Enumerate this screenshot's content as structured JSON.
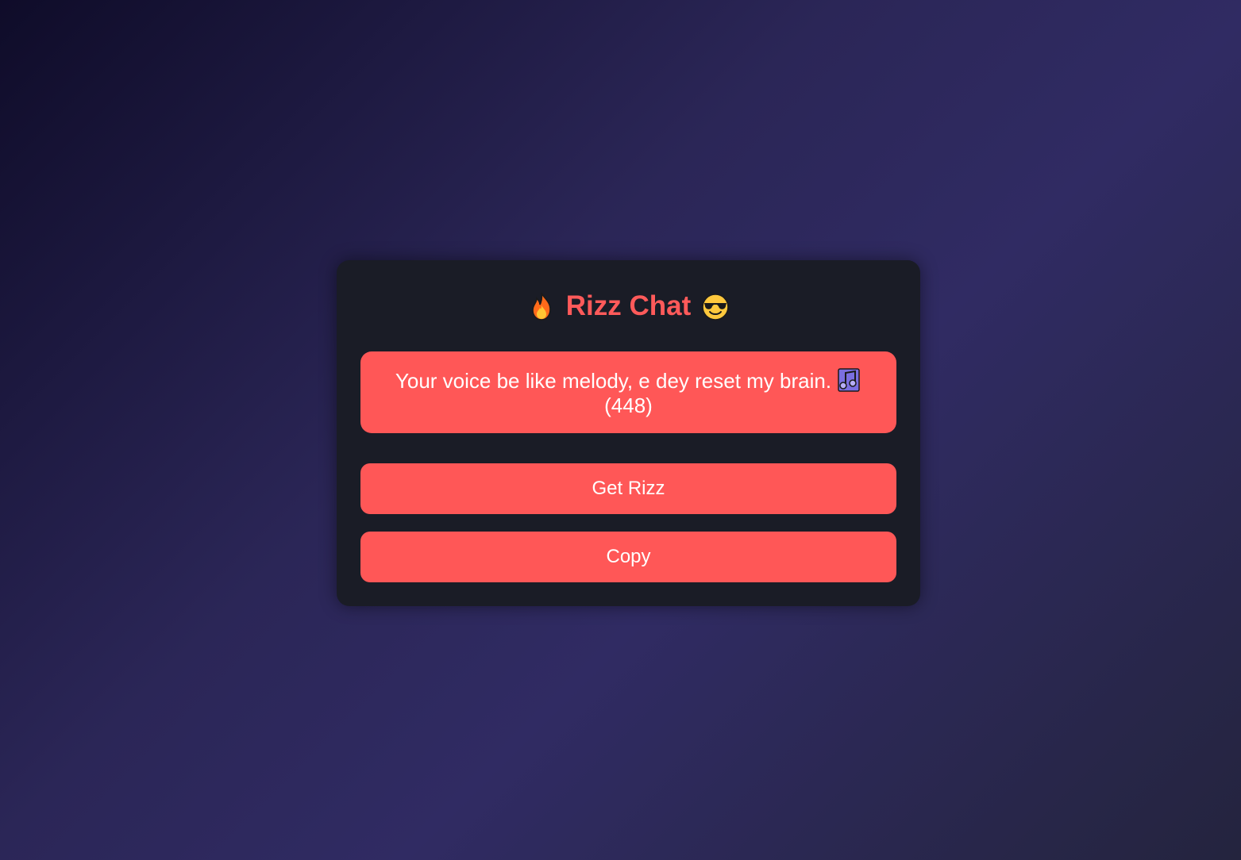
{
  "app": {
    "title": "Rizz Chat",
    "title_left_icon": "fire-icon",
    "title_right_icon": "sunglasses-face-icon"
  },
  "message": {
    "text": "Your voice be like melody, e dey reset my brain.",
    "icon": "musical-notes-icon",
    "count": "(448)"
  },
  "buttons": {
    "get_rizz": "Get Rizz",
    "copy": "Copy"
  },
  "colors": {
    "accent": "#ff5757",
    "title": "#ff5a5a",
    "card_bg": "#1a1c26",
    "text_on_accent": "#ffffff"
  }
}
